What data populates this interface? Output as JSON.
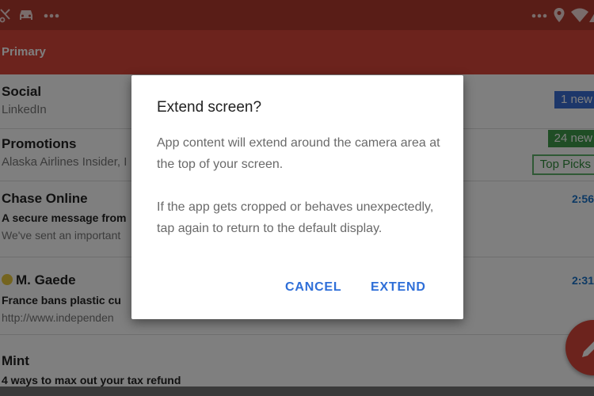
{
  "status_bar": {
    "left_icons": [
      "scissors-icon",
      "car-icon",
      "more-horizontal-icon"
    ],
    "right_icons": [
      "more-horizontal-icon",
      "location-pin-icon",
      "wifi-icon",
      "signal-icon"
    ]
  },
  "app_bar": {
    "title": "Primary"
  },
  "list": {
    "rows": [
      {
        "sender": "Social",
        "line2": "LinkedIn",
        "badge": "1 new",
        "badge_color": "#3b6fd4"
      },
      {
        "sender": "Promotions",
        "line2": "Alaska Airlines Insider, I",
        "badge": "24 new",
        "badge_color": "#3e9b4a",
        "tag": "Top Picks"
      },
      {
        "sender": "Chase Online",
        "subject": "A secure message from",
        "snippet": "We've sent an important",
        "time": "2:56"
      },
      {
        "sender": "M. Gaede",
        "subject": "France bans plastic cu",
        "snippet": "http://www.independen",
        "time": "2:31"
      },
      {
        "sender": "Mint",
        "subject": "4 ways to max out your tax refund"
      }
    ]
  },
  "fab": {
    "icon": "pencil-icon"
  },
  "dialog": {
    "title": "Extend screen?",
    "paragraph1": "App content will extend around the camera area at the top of your screen.",
    "paragraph2": "If the app gets cropped or behaves unexpectedly, tap again to return to the default display.",
    "cancel_label": "CANCEL",
    "extend_label": "EXTEND"
  },
  "colors": {
    "accent": "#d9473a",
    "status_bar": "#b23a2e",
    "dialog_button": "#2f6fd8",
    "link_time": "#1a73c8"
  }
}
